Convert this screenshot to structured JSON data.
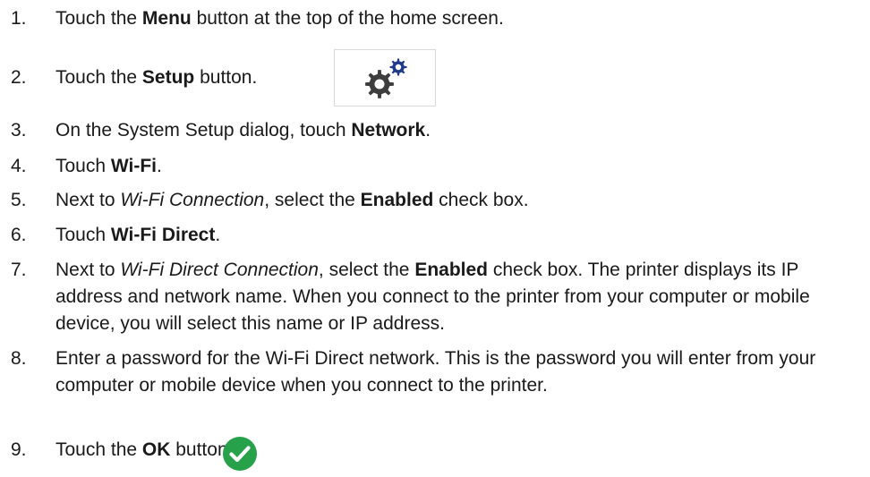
{
  "steps": [
    {
      "num": "1.",
      "parts": [
        "Touch the ",
        {
          "b": "Menu"
        },
        " button at the top of the home screen."
      ]
    },
    {
      "num": "2.",
      "parts": [
        "Touch the ",
        {
          "b": "Setup"
        },
        " button."
      ]
    },
    {
      "num": "3.",
      "parts": [
        "On the System Setup dialog, touch ",
        {
          "b": "Network"
        },
        "."
      ]
    },
    {
      "num": "4.",
      "parts": [
        "Touch ",
        {
          "b": "Wi-Fi"
        },
        "."
      ]
    },
    {
      "num": "5.",
      "parts": [
        "Next to ",
        {
          "i": "Wi-Fi Connection"
        },
        ", select the ",
        {
          "b": "Enabled"
        },
        " check box."
      ]
    },
    {
      "num": "6.",
      "parts": [
        "Touch ",
        {
          "b": "Wi-Fi Direct"
        },
        "."
      ]
    },
    {
      "num": "7.",
      "parts": [
        "Next to ",
        {
          "i": "Wi-Fi Direct Connection"
        },
        ", select the ",
        {
          "b": "Enabled"
        },
        " check box. The printer displays its IP address and network name. When you connect to the printer from your computer or mobile device, you will select this name or IP address."
      ]
    },
    {
      "num": "8.",
      "parts": [
        "Enter a password for the Wi-Fi Direct network. This is the password you will enter from your computer or mobile device when you connect to the printer."
      ]
    },
    {
      "num": "9.",
      "parts": [
        "Touch the ",
        {
          "b": "OK"
        },
        " button."
      ]
    }
  ],
  "icons": {
    "setup": "gears-icon",
    "ok": "checkmark-circle-icon",
    "setup_large_gear_color": "#3d3d3d",
    "setup_small_gear_color": "#1f3a8a",
    "ok_color": "#27a24a"
  }
}
